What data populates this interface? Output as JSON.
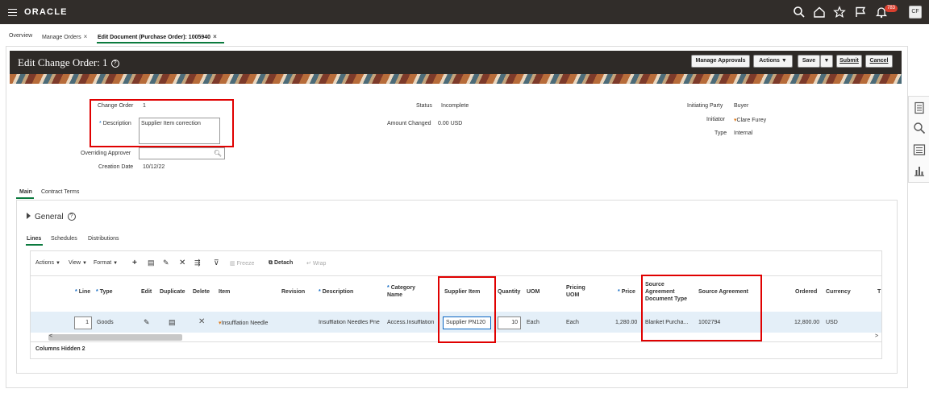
{
  "topbar": {
    "brand": "ORACLE",
    "notifications": "783",
    "user_initials": "CF"
  },
  "tabs": [
    {
      "label": "Overview"
    },
    {
      "label": "Manage Orders"
    },
    {
      "label": "Edit Document (Purchase Order): 1005940"
    }
  ],
  "header": {
    "title": "Edit Change Order: 1",
    "help": "?",
    "buttons": {
      "manage_approvals": "Manage Approvals",
      "actions": "Actions",
      "save": "Save",
      "submit": "Submit",
      "cancel": "Cancel"
    }
  },
  "form": {
    "change_order_label": "Change Order",
    "change_order_value": "1",
    "description_label": "Description",
    "description_value": "Supplier Item correction",
    "overriding_approver_label": "Overriding Approver",
    "overriding_approver_value": "",
    "creation_date_label": "Creation Date",
    "creation_date_value": "10/12/22",
    "status_label": "Status",
    "status_value": "Incomplete",
    "amount_changed_label": "Amount Changed",
    "amount_changed_value": "0.00 USD",
    "initiating_party_label": "Initiating Party",
    "initiating_party_value": "Buyer",
    "initiator_label": "Initiator",
    "initiator_value": "Clare Furey",
    "type_label": "Type",
    "type_value": "Internal"
  },
  "section_tabs": {
    "main": "Main",
    "contract_terms": "Contract Terms"
  },
  "general": {
    "label": "General"
  },
  "line_tabs": {
    "lines": "Lines",
    "schedules": "Schedules",
    "distributions": "Distributions"
  },
  "toolbar": {
    "actions": "Actions",
    "view": "View",
    "format": "Format",
    "freeze": "Freeze",
    "detach": "Detach",
    "wrap": "Wrap"
  },
  "columns": {
    "line": "Line",
    "type": "Type",
    "edit": "Edit",
    "duplicate": "Duplicate",
    "delete": "Delete",
    "item": "Item",
    "revision": "Revision",
    "description": "Description",
    "category_name_1": "Category",
    "category_name_2": "Name",
    "supplier_item": "Supplier Item",
    "quantity": "Quantity",
    "uom": "UOM",
    "pricing_uom_1": "Pricing",
    "pricing_uom_2": "UOM",
    "price": "Price",
    "sa_doc_type_1": "Source",
    "sa_doc_type_2": "Agreement",
    "sa_doc_type_3": "Document Type",
    "source_agreement": "Source Agreement",
    "ordered": "Ordered",
    "currency": "Currency",
    "t": "T"
  },
  "row": {
    "line": "1",
    "type": "Goods",
    "item": "Insufflation Needle",
    "description": "Insufflation Needles Pne",
    "category": "Access.Insufflation",
    "supplier_item": "Supplier PN120",
    "quantity": "10",
    "uom": "Each",
    "pricing_uom": "Each",
    "price": "1,280.00",
    "sa_doc_type": "Blanket Purcha...",
    "source_agreement": "1002794",
    "ordered": "12,800.00",
    "currency": "USD"
  },
  "footer": {
    "columns_hidden_label": "Columns Hidden",
    "columns_hidden_value": "2"
  }
}
